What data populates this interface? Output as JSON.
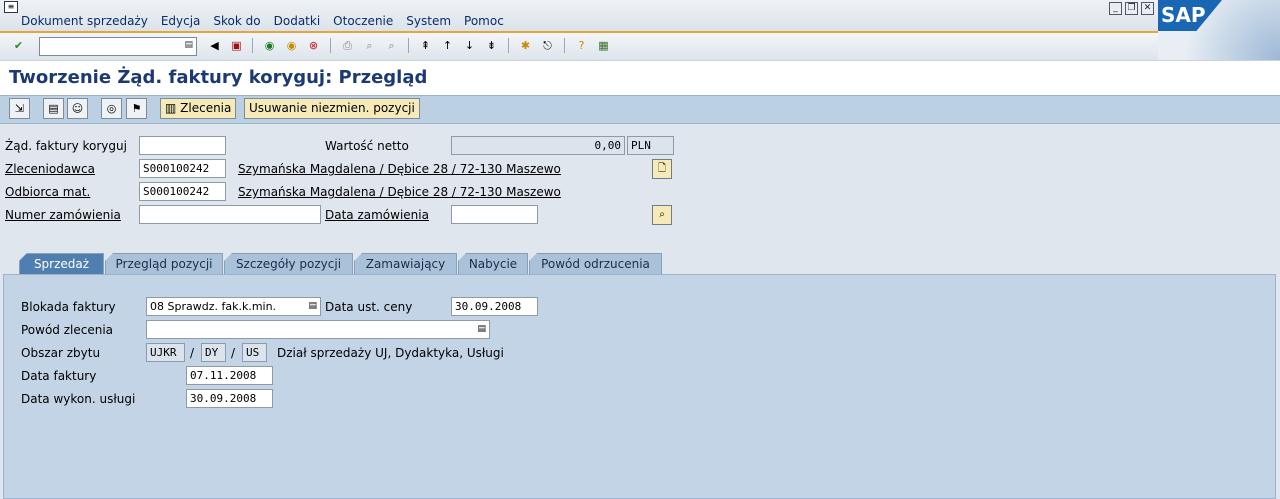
{
  "menu": [
    "Dokument sprzedaży",
    "Edycja",
    "Skok do",
    "Dodatki",
    "Otoczenie",
    "System",
    "Pomoc"
  ],
  "brand": "SAP",
  "window_icons": [
    "minimize-icon",
    "restore-icon",
    "close-icon"
  ],
  "title": "Tworzenie Żąd. faktury koryguj: Przegląd",
  "app_toolbar": {
    "orders_label": "Zlecenia",
    "remove_label": "Usuwanie niezmien. pozycji"
  },
  "header": {
    "invoice_request": {
      "label": "Żąd. faktury koryguj",
      "value": ""
    },
    "net_value": {
      "label": "Wartość netto",
      "value": "0,00",
      "currency": "PLN"
    },
    "sold_to": {
      "label": "Zleceniodawca",
      "value": "S000100242",
      "desc": "Szymańska Magdalena / Dębice 28 / 72-130 Maszewo"
    },
    "ship_to": {
      "label": "Odbiorca mat.",
      "value": "S000100242",
      "desc": "Szymańska Magdalena / Dębice 28 / 72-130 Maszewo"
    },
    "po_number": {
      "label": "Numer zamówienia",
      "value": ""
    },
    "po_date": {
      "label": "Data zamówienia",
      "value": ""
    }
  },
  "tabs": [
    "Sprzedaż",
    "Przegląd pozycji",
    "Szczegóły pozycji",
    "Zamawiający",
    "Nabycie",
    "Powód odrzucenia"
  ],
  "sales_tab": {
    "billing_block": {
      "label": "Blokada faktury",
      "value": "08 Sprawdz. fak.k.min."
    },
    "pricing_date": {
      "label": "Data ust. ceny",
      "value": "30.09.2008"
    },
    "order_reason": {
      "label": "Powód zlecenia",
      "value": ""
    },
    "sales_area": {
      "label": "Obszar zbytu",
      "org": "UJKR",
      "channel": "DY",
      "division": "US",
      "sep": "/",
      "desc": "Dział sprzedaży UJ, Dydaktyka, Usługi"
    },
    "billing_date": {
      "label": "Data faktury",
      "value": "07.11.2008"
    },
    "service_date": {
      "label": "Data wykon. usługi",
      "value": "30.09.2008"
    }
  },
  "colors": {
    "accent": "#e8a33a",
    "title": "#1b3a73",
    "tab_active": "#4f7fb0",
    "panel": "#c3d4e6"
  }
}
